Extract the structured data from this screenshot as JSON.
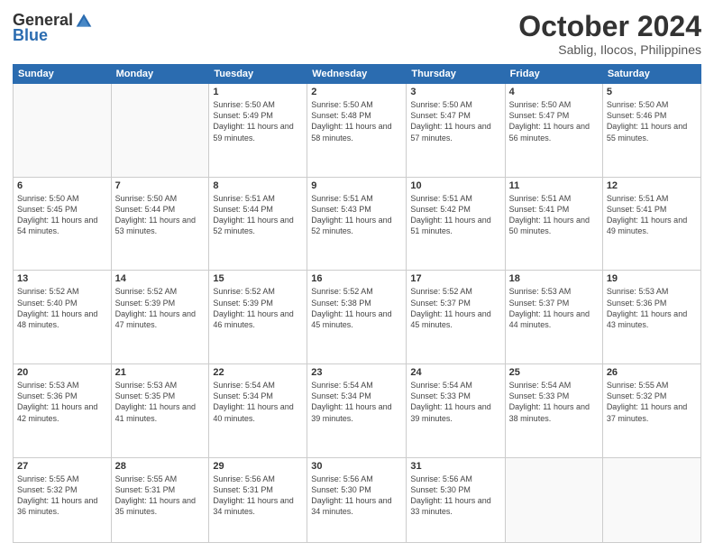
{
  "header": {
    "logo_general": "General",
    "logo_blue": "Blue",
    "month": "October 2024",
    "location": "Sablig, Ilocos, Philippines"
  },
  "weekdays": [
    "Sunday",
    "Monday",
    "Tuesday",
    "Wednesday",
    "Thursday",
    "Friday",
    "Saturday"
  ],
  "weeks": [
    [
      {
        "day": "",
        "info": ""
      },
      {
        "day": "",
        "info": ""
      },
      {
        "day": "1",
        "info": "Sunrise: 5:50 AM\nSunset: 5:49 PM\nDaylight: 11 hours and 59 minutes."
      },
      {
        "day": "2",
        "info": "Sunrise: 5:50 AM\nSunset: 5:48 PM\nDaylight: 11 hours and 58 minutes."
      },
      {
        "day": "3",
        "info": "Sunrise: 5:50 AM\nSunset: 5:47 PM\nDaylight: 11 hours and 57 minutes."
      },
      {
        "day": "4",
        "info": "Sunrise: 5:50 AM\nSunset: 5:47 PM\nDaylight: 11 hours and 56 minutes."
      },
      {
        "day": "5",
        "info": "Sunrise: 5:50 AM\nSunset: 5:46 PM\nDaylight: 11 hours and 55 minutes."
      }
    ],
    [
      {
        "day": "6",
        "info": "Sunrise: 5:50 AM\nSunset: 5:45 PM\nDaylight: 11 hours and 54 minutes."
      },
      {
        "day": "7",
        "info": "Sunrise: 5:50 AM\nSunset: 5:44 PM\nDaylight: 11 hours and 53 minutes."
      },
      {
        "day": "8",
        "info": "Sunrise: 5:51 AM\nSunset: 5:44 PM\nDaylight: 11 hours and 52 minutes."
      },
      {
        "day": "9",
        "info": "Sunrise: 5:51 AM\nSunset: 5:43 PM\nDaylight: 11 hours and 52 minutes."
      },
      {
        "day": "10",
        "info": "Sunrise: 5:51 AM\nSunset: 5:42 PM\nDaylight: 11 hours and 51 minutes."
      },
      {
        "day": "11",
        "info": "Sunrise: 5:51 AM\nSunset: 5:41 PM\nDaylight: 11 hours and 50 minutes."
      },
      {
        "day": "12",
        "info": "Sunrise: 5:51 AM\nSunset: 5:41 PM\nDaylight: 11 hours and 49 minutes."
      }
    ],
    [
      {
        "day": "13",
        "info": "Sunrise: 5:52 AM\nSunset: 5:40 PM\nDaylight: 11 hours and 48 minutes."
      },
      {
        "day": "14",
        "info": "Sunrise: 5:52 AM\nSunset: 5:39 PM\nDaylight: 11 hours and 47 minutes."
      },
      {
        "day": "15",
        "info": "Sunrise: 5:52 AM\nSunset: 5:39 PM\nDaylight: 11 hours and 46 minutes."
      },
      {
        "day": "16",
        "info": "Sunrise: 5:52 AM\nSunset: 5:38 PM\nDaylight: 11 hours and 45 minutes."
      },
      {
        "day": "17",
        "info": "Sunrise: 5:52 AM\nSunset: 5:37 PM\nDaylight: 11 hours and 45 minutes."
      },
      {
        "day": "18",
        "info": "Sunrise: 5:53 AM\nSunset: 5:37 PM\nDaylight: 11 hours and 44 minutes."
      },
      {
        "day": "19",
        "info": "Sunrise: 5:53 AM\nSunset: 5:36 PM\nDaylight: 11 hours and 43 minutes."
      }
    ],
    [
      {
        "day": "20",
        "info": "Sunrise: 5:53 AM\nSunset: 5:36 PM\nDaylight: 11 hours and 42 minutes."
      },
      {
        "day": "21",
        "info": "Sunrise: 5:53 AM\nSunset: 5:35 PM\nDaylight: 11 hours and 41 minutes."
      },
      {
        "day": "22",
        "info": "Sunrise: 5:54 AM\nSunset: 5:34 PM\nDaylight: 11 hours and 40 minutes."
      },
      {
        "day": "23",
        "info": "Sunrise: 5:54 AM\nSunset: 5:34 PM\nDaylight: 11 hours and 39 minutes."
      },
      {
        "day": "24",
        "info": "Sunrise: 5:54 AM\nSunset: 5:33 PM\nDaylight: 11 hours and 39 minutes."
      },
      {
        "day": "25",
        "info": "Sunrise: 5:54 AM\nSunset: 5:33 PM\nDaylight: 11 hours and 38 minutes."
      },
      {
        "day": "26",
        "info": "Sunrise: 5:55 AM\nSunset: 5:32 PM\nDaylight: 11 hours and 37 minutes."
      }
    ],
    [
      {
        "day": "27",
        "info": "Sunrise: 5:55 AM\nSunset: 5:32 PM\nDaylight: 11 hours and 36 minutes."
      },
      {
        "day": "28",
        "info": "Sunrise: 5:55 AM\nSunset: 5:31 PM\nDaylight: 11 hours and 35 minutes."
      },
      {
        "day": "29",
        "info": "Sunrise: 5:56 AM\nSunset: 5:31 PM\nDaylight: 11 hours and 34 minutes."
      },
      {
        "day": "30",
        "info": "Sunrise: 5:56 AM\nSunset: 5:30 PM\nDaylight: 11 hours and 34 minutes."
      },
      {
        "day": "31",
        "info": "Sunrise: 5:56 AM\nSunset: 5:30 PM\nDaylight: 11 hours and 33 minutes."
      },
      {
        "day": "",
        "info": ""
      },
      {
        "day": "",
        "info": ""
      }
    ]
  ]
}
